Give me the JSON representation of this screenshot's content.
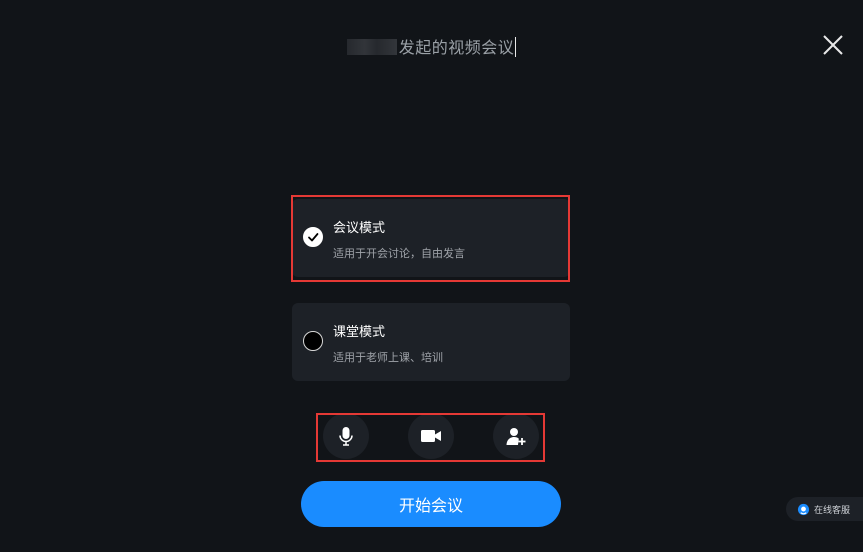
{
  "header": {
    "title": "发起的视频会议",
    "close_icon": "close-icon"
  },
  "modes": [
    {
      "title": "会议模式",
      "description": "适用于开会讨论，自由发言",
      "selected": true
    },
    {
      "title": "课堂模式",
      "description": "适用于老师上课、培训",
      "selected": false
    }
  ],
  "controls": {
    "microphone_icon": "microphone-icon",
    "camera_icon": "camera-icon",
    "add_participant_icon": "add-participant-icon"
  },
  "start_button": {
    "label": "开始会议"
  },
  "online_service": {
    "label": "在线客服"
  },
  "colors": {
    "background": "#111418",
    "card": "#1d2127",
    "accent": "#1a8cff",
    "highlight": "#e53935"
  }
}
